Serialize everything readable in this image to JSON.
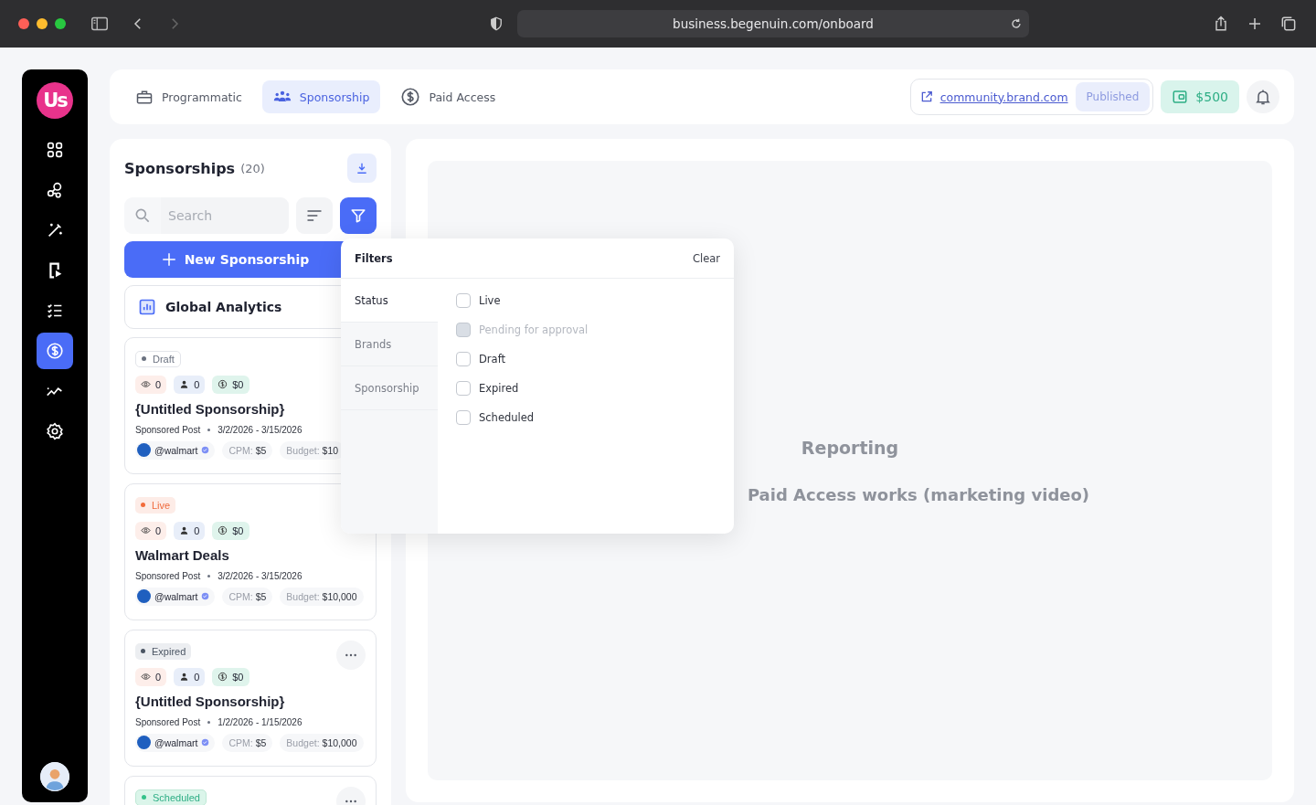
{
  "browser": {
    "url": "business.begenuin.com/onboard"
  },
  "sidebar": {
    "logo": "Us",
    "items": [
      {
        "selected": false
      },
      {
        "selected": false
      },
      {
        "selected": false
      },
      {
        "selected": false
      },
      {
        "selected": false
      },
      {
        "selected": true
      },
      {
        "selected": false
      },
      {
        "selected": false
      }
    ]
  },
  "top_bar": {
    "tabs": [
      {
        "label": "Programmatic",
        "selected": false
      },
      {
        "label": "Sponsorship",
        "selected": true
      },
      {
        "label": "Paid Access",
        "selected": false
      }
    ],
    "link": "community.brand.com",
    "publish_button": {
      "label": "Published",
      "disabled": true
    },
    "balance": "$500"
  },
  "sponsorships": {
    "title": "Sponsorships",
    "count": "(20)",
    "search": {
      "placeholder": "Search"
    },
    "filter_active": true,
    "new_button": "New Sponsorship",
    "analytics": "Global Analytics",
    "cards": [
      {
        "status": {
          "label": "Draft",
          "kind": "draft",
          "color": "#6b7280"
        },
        "views": "0",
        "members": "0",
        "earnings": "$0",
        "title": "{Untitled Sponsorship}",
        "type": "Sponsored Post",
        "dates": "3/2/2026 - 3/15/2026",
        "handle": "@walmart",
        "verified": true,
        "cpm_label": "CPM:",
        "cpm": "$5",
        "budget_label": "Budget:",
        "budget": "$10",
        "menu": false
      },
      {
        "status": {
          "label": "Live",
          "kind": "live",
          "color": "#f26b3a"
        },
        "views": "0",
        "members": "0",
        "earnings": "$0",
        "title": "Walmart Deals",
        "type": "Sponsored Post",
        "dates": "3/2/2026 - 3/15/2026",
        "handle": "@walmart",
        "verified": true,
        "cpm_label": "CPM:",
        "cpm": "$5",
        "budget_label": "Budget:",
        "budget": "$10,000",
        "menu": false
      },
      {
        "status": {
          "label": "Expired",
          "kind": "expired",
          "color": "#4b5563"
        },
        "views": "0",
        "members": "0",
        "earnings": "$0",
        "title": "{Untitled Sponsorship}",
        "type": "Sponsored Post",
        "dates": "1/2/2026 - 1/15/2026",
        "handle": "@walmart",
        "verified": true,
        "cpm_label": "CPM:",
        "cpm": "$5",
        "budget_label": "Budget:",
        "budget": "$10,000",
        "menu": true
      },
      {
        "status": {
          "label": "Scheduled",
          "kind": "scheduled",
          "color": "#34c28a"
        },
        "menu": true
      }
    ]
  },
  "filters": {
    "title": "Filters",
    "clear": "Clear",
    "categories": [
      {
        "label": "Status",
        "selected": true
      },
      {
        "label": "Brands",
        "selected": false
      },
      {
        "label": "Sponsorship",
        "selected": false
      }
    ],
    "options": [
      {
        "label": "Live",
        "checked": false,
        "disabled": false
      },
      {
        "label": "Pending for approval",
        "checked": false,
        "disabled": true
      },
      {
        "label": "Draft",
        "checked": false,
        "disabled": false
      },
      {
        "label": "Expired",
        "checked": false,
        "disabled": false
      },
      {
        "label": "Scheduled",
        "checked": false,
        "disabled": false
      }
    ]
  },
  "reporting": {
    "title": "Reporting",
    "subtitle": "Paid Access works (marketing video)"
  }
}
